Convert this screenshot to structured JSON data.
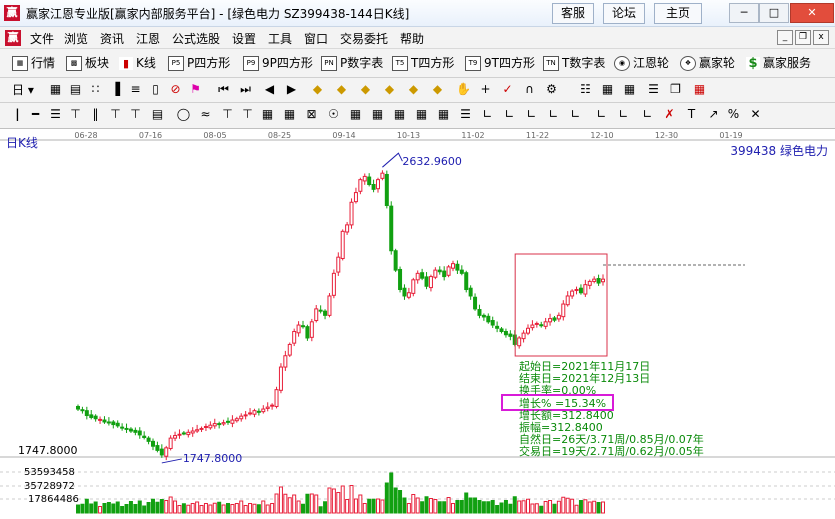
{
  "window": {
    "title": "赢家江恩专业版[赢家内部服务平台] - [绿色电力  SZ399438-144日K线]",
    "app_icon": "赢",
    "links": [
      "客服",
      "论坛",
      "主页"
    ],
    "controls": [
      "minimize",
      "maximize",
      "close"
    ]
  },
  "menu": {
    "items": [
      "文件",
      "浏览",
      "资讯",
      "江恩",
      "公式选股",
      "设置",
      "工具",
      "窗口",
      "交易委托",
      "帮助"
    ],
    "app_icon": "赢"
  },
  "toolbar1": {
    "items": [
      {
        "label": "行情",
        "icon": "grid-icon"
      },
      {
        "label": "板块",
        "icon": "blocks-icon"
      },
      {
        "label": "K线",
        "icon": "candlestick-icon"
      },
      {
        "label": "P四方形",
        "icon": "P4",
        "icon_text": "P5"
      },
      {
        "label": "9P四方形",
        "icon": "9P",
        "icon_text": "P9"
      },
      {
        "label": "P数字表",
        "icon": "PN",
        "icon_text": "PN"
      },
      {
        "label": "T四方形",
        "icon": "T5",
        "icon_text": "T5"
      },
      {
        "label": "9T四方形",
        "icon": "T9",
        "icon_text": "T9"
      },
      {
        "label": "T数字表",
        "icon": "TN",
        "icon_text": "TN"
      },
      {
        "label": "江恩轮",
        "icon": "target-icon"
      },
      {
        "label": "赢家轮",
        "icon": "wheel-icon"
      },
      {
        "label": "赢家服务",
        "icon": "dollar-icon"
      }
    ]
  },
  "toolbar2": {
    "period_label": "日"
  },
  "chart_data": {
    "type": "candlestick",
    "title": "日K线",
    "symbol_label": "399438  绿色电力",
    "x_ticks": [
      "06-28",
      "07-16",
      "08-05",
      "08-25",
      "09-14",
      "10-13",
      "11-02",
      "11-22",
      "12-10",
      "12-30",
      "01-19"
    ],
    "high_label": "2632.9600",
    "low_label": "1747.8000",
    "axis_price_label": "1747.8000",
    "volume_ticks": [
      "53593458",
      "35728972",
      "17864486"
    ],
    "selection_box": {
      "start_index": 100,
      "end_index": 119
    },
    "stats": {
      "start_date": "起始日=2021年11月17日",
      "end_date": "结束日=2021年12月13日",
      "turnover": "换手率=0.00%",
      "growth": "增长% =15.34%",
      "growth_amount": "增长额=312.8400",
      "amplitude": "振幅=312.8400",
      "natural_days": "自然日=26天/3.71周/0.85月/0.07年",
      "trade_days": "交易日=19天/2.71周/0.62月/0.05年"
    },
    "closes": [
      1890,
      1885,
      1870,
      1864,
      1860,
      1858,
      1850,
      1848,
      1842,
      1838,
      1832,
      1828,
      1822,
      1818,
      1810,
      1802,
      1790,
      1775,
      1762,
      1748,
      1770,
      1800,
      1808,
      1812,
      1815,
      1818,
      1822,
      1826,
      1830,
      1836,
      1840,
      1845,
      1842,
      1848,
      1850,
      1856,
      1860,
      1868,
      1872,
      1878,
      1885,
      1882,
      1890,
      1896,
      1902,
      1950,
      2020,
      2055,
      2090,
      2130,
      2150,
      2145,
      2110,
      2160,
      2200,
      2195,
      2180,
      2240,
      2310,
      2360,
      2440,
      2460,
      2530,
      2560,
      2600,
      2610,
      2585,
      2570,
      2600,
      2620,
      2520,
      2380,
      2320,
      2260,
      2240,
      2250,
      2290,
      2310,
      2295,
      2270,
      2300,
      2320,
      2315,
      2300,
      2330,
      2340,
      2320,
      2310,
      2260,
      2240,
      2200,
      2180,
      2175,
      2160,
      2150,
      2140,
      2130,
      2120,
      2115,
      2090,
      2110,
      2125,
      2140,
      2150,
      2155,
      2148,
      2160,
      2170,
      2165,
      2180,
      2215,
      2240,
      2255,
      2260,
      2250,
      2275,
      2285,
      2292,
      2280,
      2292
    ]
  },
  "colors": {
    "up": "#e8203a",
    "down": "#11a011",
    "axis_text": "#2020b0",
    "stat_text": "#0a8a0a",
    "highlight": "#d81bd8",
    "selection": "#d8304a"
  }
}
